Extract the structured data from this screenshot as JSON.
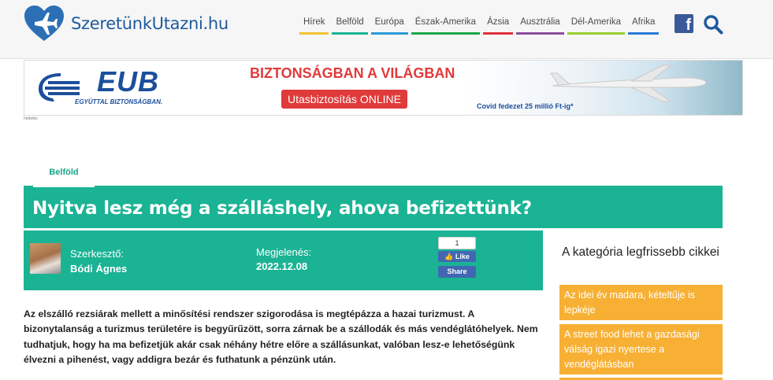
{
  "site": {
    "name": "SzeretünkUtazni.hu"
  },
  "nav": {
    "items": [
      {
        "label": "Hírek",
        "color": "#f2c230"
      },
      {
        "label": "Belföld",
        "color": "#1ab394"
      },
      {
        "label": "Európa",
        "color": "#2b9ad6"
      },
      {
        "label": "Észak-Amerika",
        "color": "#1aa64a"
      },
      {
        "label": "Ázsia",
        "color": "#e0323c"
      },
      {
        "label": "Ausztrália",
        "color": "#8a4f9e"
      },
      {
        "label": "Dél-Amerika",
        "color": "#9acd32"
      },
      {
        "label": "Afrika",
        "color": "#2b7bd6"
      }
    ]
  },
  "ad": {
    "brand": "EUB",
    "tagline": "EGYÜTTAL BIZTONSÁGBAN.",
    "headline": "BIZTONSÁGBAN A VILÁGBAN",
    "button": "Utasbiztosítás ONLINE",
    "covid": "Covid fedezet 25 millió Ft-ig*",
    "note": "hirdetés"
  },
  "article": {
    "category": "Belföld",
    "title": "Nyitva lesz még a szálláshely, ahova befizettünk?",
    "editor_label": "Szerkesztő:",
    "editor_name": "Bódi Ágnes",
    "published_label": "Megjelenés:",
    "published_date": "2022.12.08",
    "like_count": "1",
    "like_label": "Like",
    "share_label": "Share",
    "body": "Az elszálló rezsiárak mellett a minősítési rendszer szigorodása is megtépázza a hazai turizmust. A bizonytalanság a turizmus területére is begyűrűzött, sorra zárnak be a szállodák és más vendéglátóhelyek. Nem tudhatjuk, hogy ha ma befizetjük akár csak néhány hétre előre a szállásunkat, valóban lesz-e lehetőségünk élvezni a pihenést, vagy addigra bezár és futhatunk a pénzünk után."
  },
  "sidebar": {
    "title": "A kategória legfrissebb cikkei",
    "items": [
      {
        "label": "Az idei év madara, kételtűje is lepkéje"
      },
      {
        "label": "A street food lehet a gazdasági válság igazi nyertese a vendéglátásban"
      }
    ]
  },
  "colors": {
    "accent": "#1ab394",
    "brand": "#1f5a9e",
    "sidebar": "#f7b034"
  }
}
